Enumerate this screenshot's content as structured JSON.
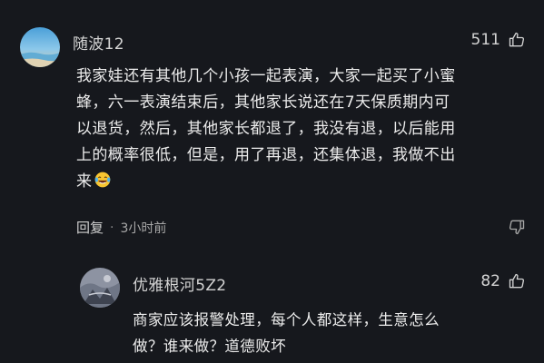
{
  "comments": [
    {
      "username": "随波12",
      "likes": "511",
      "lines": [
        "我家娃还有其他几个小孩一起表演，大家一起买了小蜜",
        "蜂，六一表演结束后，其他家长说还在7天保质期内可",
        "以退货，然后，其他家长都退了，我没有退，以后能用",
        "上的概率很低，但是，用了再退，还集体退，我做不出",
        "来"
      ],
      "emoji": "laughing-tears-emoji",
      "reply_label": "回复",
      "time": "3小时前"
    }
  ],
  "reply": {
    "username": "优雅根河5Z2",
    "likes": "82",
    "lines": [
      "商家应该报警处理，每个人都这样，生意怎么",
      "做？谁来做？道德败坏"
    ]
  },
  "icons": {
    "like": "thumbs-up-icon",
    "dislike": "thumbs-down-icon"
  },
  "colors": {
    "background": "#16181d",
    "text": "#ececec",
    "muted": "#a8a8a8"
  }
}
